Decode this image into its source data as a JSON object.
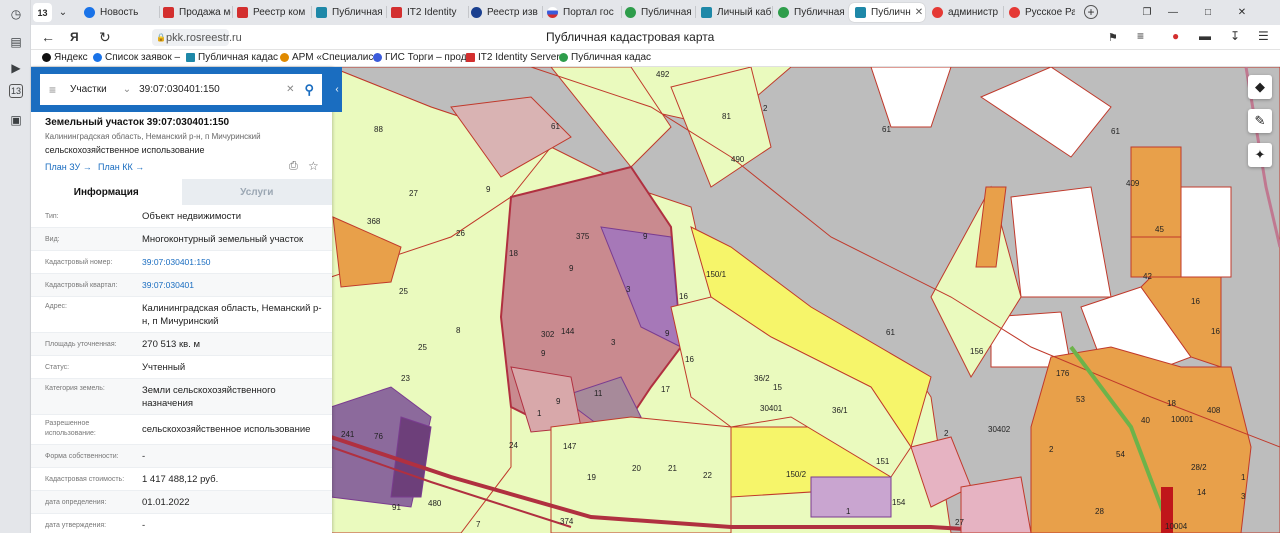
{
  "browser": {
    "rail": {
      "tab_count": "13"
    },
    "tabs": [
      {
        "label": "13",
        "color": "#5f6368"
      },
      {
        "label": "Новость",
        "color": "#1a73e8"
      },
      {
        "label": "Продажа ме",
        "color": "#d32f2f"
      },
      {
        "label": "Реестр ком",
        "color": "#d32f2f"
      },
      {
        "label": "Публичная",
        "color": "#1e88a8"
      },
      {
        "label": "IT2 Identity",
        "color": "#d32f2f"
      },
      {
        "label": "Реестр изв",
        "color": "#1a3f8f"
      },
      {
        "label": "Портал гос",
        "color": "#3b5bdb"
      },
      {
        "label": "Публичная",
        "color": "#2e9d4b"
      },
      {
        "label": "Личный каб",
        "color": "#1e88a8"
      },
      {
        "label": "Публичная",
        "color": "#2e9d4b"
      },
      {
        "label": "Публичн",
        "color": "#1e88a8",
        "close": "✕"
      },
      {
        "label": "администр",
        "color": "#e53935"
      },
      {
        "label": "Русское Ра",
        "color": "#e53935"
      }
    ],
    "url": "pkk.rosreestr.ru",
    "page_title": "Публичная кадастровая карта",
    "bookmarks": [
      {
        "label": "Яндекс",
        "color": "#111"
      },
      {
        "label": "Список заявок –",
        "color": "#1a73e8"
      },
      {
        "label": "Публичная кадас",
        "color": "#1e88a8"
      },
      {
        "label": "АРМ «Специалис",
        "color": "#e08a00"
      },
      {
        "label": "ГИС Торги – прод",
        "color": "#3b5bdb"
      },
      {
        "label": "IT2 Identity Server",
        "color": "#d32f2f"
      },
      {
        "label": "Публичная кадас",
        "color": "#2e9d4b"
      }
    ]
  },
  "search": {
    "category": "Участки",
    "query": "39:07:030401:150"
  },
  "parcel": {
    "title": "Земельный участок 39:07:030401:150",
    "address_short": "Калининградская область, Неманский р-н, п Мичуринский",
    "use": "сельскохозяйственное использование",
    "plan_zu": "План ЗУ →",
    "plan_kk": "План КК →"
  },
  "tabs": {
    "info": "Информация",
    "services": "Услуги"
  },
  "attributes": [
    {
      "key": "Тип:",
      "value": "Объект недвижимости",
      "link": false
    },
    {
      "key": "Вид:",
      "value": "Многоконтурный земельный участок",
      "link": false
    },
    {
      "key": "Кадастровый номер:",
      "value": "39:07:030401:150",
      "link": true
    },
    {
      "key": "Кадастровый квартал:",
      "value": "39:07:030401",
      "link": true
    },
    {
      "key": "Адрес:",
      "value": "Калининградская область, Неманский р-н, п Мичуринский",
      "link": false
    },
    {
      "key": "Площадь уточненная:",
      "value": "270 513 кв. м",
      "link": false
    },
    {
      "key": "Статус:",
      "value": "Учтенный",
      "link": false
    },
    {
      "key": "Категория земель:",
      "value": "Земли сельскохозяйственного назначения",
      "link": false
    },
    {
      "key": "Разрешенное использование:",
      "value": "сельскохозяйственное использование",
      "link": false
    },
    {
      "key": "Форма собственности:",
      "value": "-",
      "link": false
    },
    {
      "key": "Кадастровая стоимость:",
      "value": "1 417 488,12 руб.",
      "link": false
    },
    {
      "key": "дата определения:",
      "value": "01.01.2022",
      "link": false
    },
    {
      "key": "дата утверждения:",
      "value": "-",
      "link": false
    }
  ],
  "map": {
    "labels": [
      "88",
      "61",
      "81",
      "2",
      "61",
      "492",
      "490",
      "61",
      "27",
      "9",
      "26",
      "368",
      "375",
      "9",
      "18",
      "9",
      "8",
      "25",
      "25",
      "23",
      "9",
      "3",
      "3",
      "16",
      "150/1",
      "9",
      "16",
      "17",
      "11",
      "1",
      "9",
      "302",
      "144",
      "24",
      "19",
      "20",
      "21",
      "22",
      "36/2",
      "15",
      "30401",
      "36/1",
      "150/2",
      "61",
      "156",
      "151",
      "2",
      "30402",
      "2",
      "154",
      "1",
      "27",
      "409",
      "45",
      "42",
      "16",
      "16",
      "176",
      "53",
      "18",
      "10001",
      "408",
      "40",
      "54",
      "28/2",
      "14",
      "1",
      "3",
      "241",
      "76",
      "91",
      "480",
      "7",
      "374",
      "147",
      "10004",
      "28"
    ]
  }
}
